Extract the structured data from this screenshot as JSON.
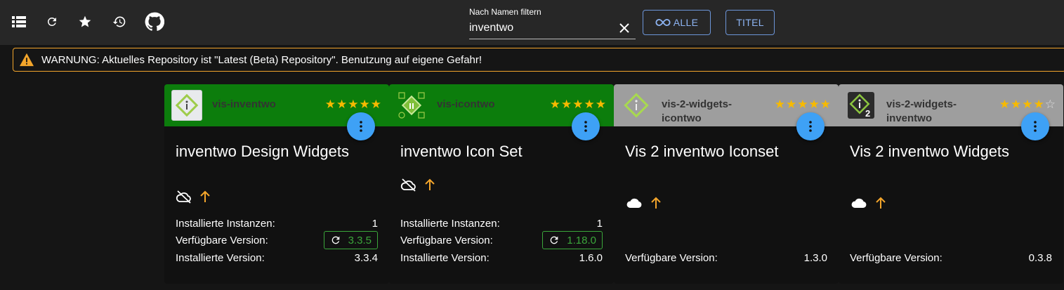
{
  "toolbar": {
    "filter_label": "Nach Namen filtern",
    "filter_value": "inventwo",
    "btn_all": "ALLE",
    "btn_title": "TITEL"
  },
  "warning": {
    "text": "WARNUNG: Aktuelles Repository ist \"Latest (Beta) Repository\". Benutzung auf eigene Gefahr!"
  },
  "labels": {
    "installed_instances": "Installierte Instanzen:",
    "available_version": "Verfügbare Version:",
    "installed_version": "Installierte Version:"
  },
  "cards": [
    {
      "name": "vis-inventwo",
      "title": "inventwo Design Widgets",
      "rating": 5,
      "header_color": "#0c7d0c",
      "instances": "1",
      "available": "3.3.5",
      "installed": "3.3.4"
    },
    {
      "name": "vis-icontwo",
      "title": "inventwo Icon Set",
      "rating": 5,
      "header_color": "#0c7d0c",
      "instances": "1",
      "available": "1.18.0",
      "installed": "1.6.0"
    },
    {
      "name": "vis-2-widgets-icontwo",
      "title": "Vis 2 inventwo Iconset",
      "rating": 5,
      "header_color": "#9e9e9e",
      "available": "1.3.0"
    },
    {
      "name": "vis-2-widgets-inventwo",
      "title": "Vis 2 inventwo Widgets",
      "rating": 4,
      "header_color": "#9e9e9e",
      "available": "0.3.8"
    }
  ],
  "colors": {
    "accent": "#3ea1f6",
    "warning": "#f3a52b",
    "star": "#f7ba00",
    "update": "#3ba73b"
  }
}
